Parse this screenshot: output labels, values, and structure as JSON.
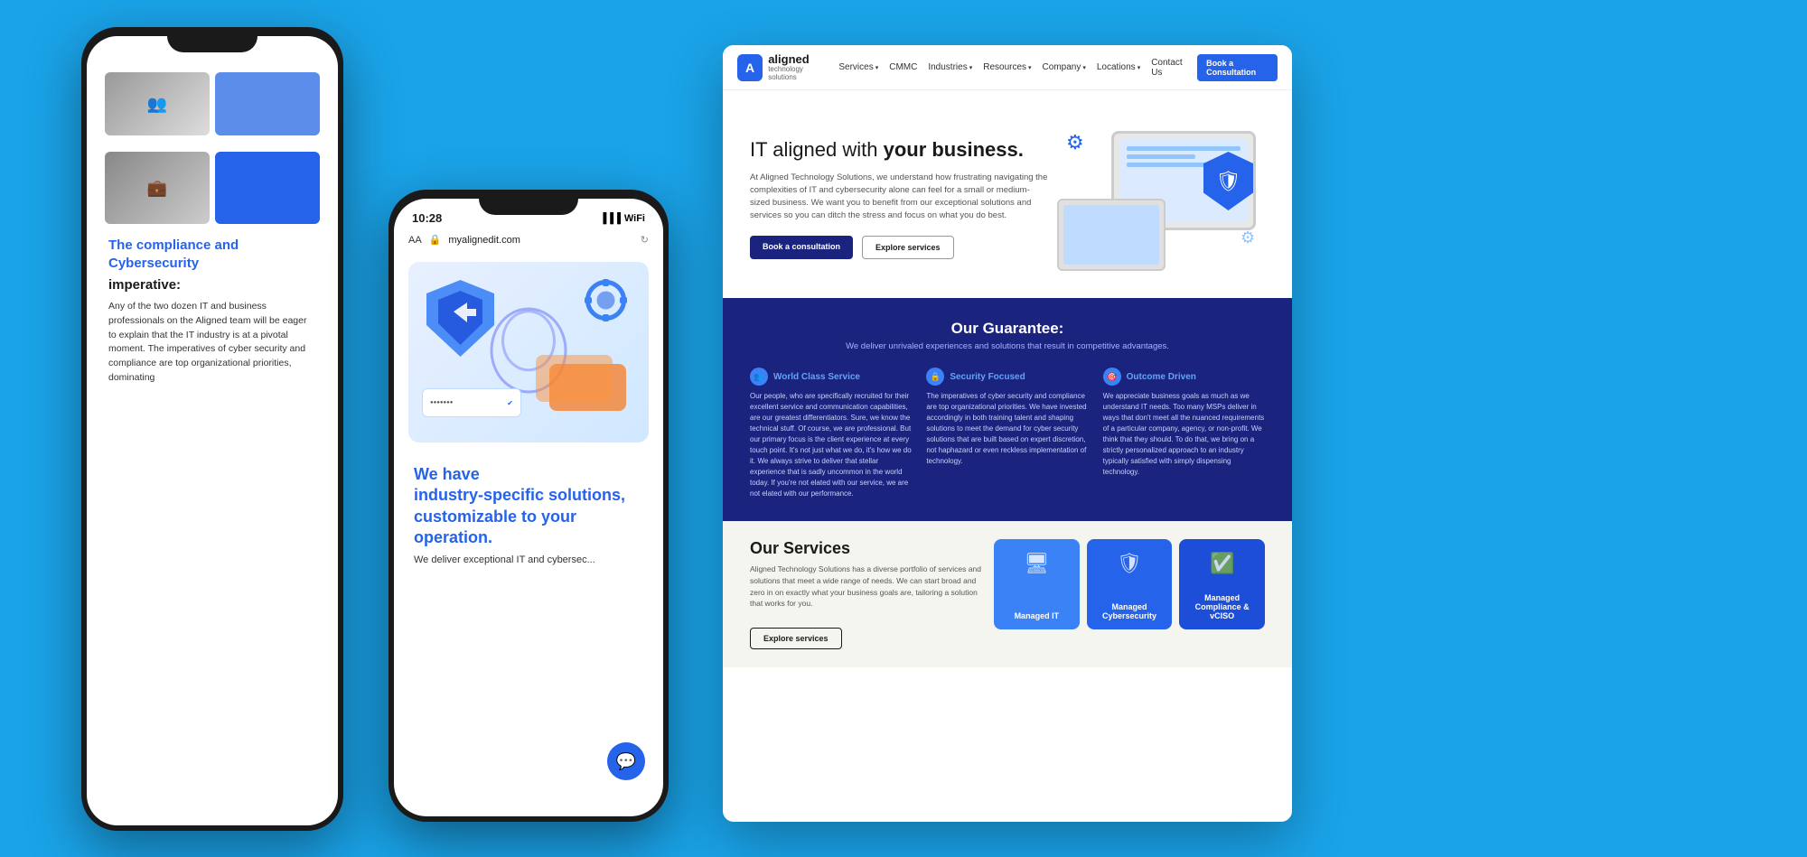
{
  "background_color": "#1aa3e8",
  "phone_left": {
    "heading_blue": "The compliance and Cybersecurity",
    "heading_bold": "imperative:",
    "body_text": "Any of the two dozen IT and business professionals on the Aligned team will be eager to explain that the IT industry is at a pivotal moment. The imperatives of cyber security and compliance are top organizational priorities, dominating"
  },
  "phone_mid": {
    "status_bar": {
      "time": "10:28",
      "url": "myalignedit.com",
      "aa_label": "AA"
    },
    "heading_line1": "We have",
    "heading_line2": "industry-specific solutions,",
    "heading_bold": "customizable to your operation.",
    "subtext": "We deliver exceptional IT and cybersec..."
  },
  "browser": {
    "nav": {
      "logo_text": "aligned",
      "logo_sub": "technology solutions",
      "links": [
        "Services",
        "CMMC",
        "Industries",
        "Resources",
        "Company",
        "Locations",
        "Contact Us"
      ],
      "cta_button": "Book a Consultation"
    },
    "hero": {
      "title_normal": "IT aligned with",
      "title_bold": "your business.",
      "body": "At Aligned Technology Solutions, we understand how frustrating navigating the complexities of IT and cybersecurity alone can feel for a small or medium-sized business. We want you to benefit from our exceptional solutions and services so you can ditch the stress and focus on what you do best.",
      "btn_consultation": "Book a consultation",
      "btn_services": "Explore services"
    },
    "guarantee": {
      "title": "Our Guarantee:",
      "subtitle": "We deliver unrivaled experiences and solutions that result in competitive advantages.",
      "cols": [
        {
          "title": "World Class Service",
          "body": "Our people, who are specifically recruited for their excellent service and communication capabilities, are our greatest differentiators. Sure, we know the technical stuff. Of course, we are professional. But our primary focus is the client experience at every touch point. It's not just what we do, it's how we do it. We always strive to deliver that stellar experience that is sadly uncommon in the world today. If you're not elated with our service, we are not elated with our performance."
        },
        {
          "title": "Security Focused",
          "body": "The imperatives of cyber security and compliance are top organizational priorities. We have invested accordingly in both training talent and shaping solutions to meet the demand for cyber security solutions that are built based on expert discretion, not haphazard or even reckless implementation of technology."
        },
        {
          "title": "Outcome Driven",
          "body": "We appreciate business goals as much as we understand IT needs. Too many MSPs deliver in ways that don't meet all the nuanced requirements of a particular company, agency, or non-profit. We think that they should. To do that, we bring on a strictly personalized approach to an industry typically satisfied with simply dispensing technology."
        }
      ]
    },
    "services": {
      "title": "Our Services",
      "body": "Aligned Technology Solutions has a diverse portfolio of services and solutions that meet a wide range of needs. We can start broad and zero in on exactly what your business goals are, tailoring a solution that works for you.",
      "btn": "Explore services",
      "cards": [
        {
          "label": "Managed IT",
          "color": "blue1"
        },
        {
          "label": "Managed Cybersecurity",
          "color": "blue2"
        },
        {
          "label": "Managed Compliance & vCISO",
          "color": "blue3"
        }
      ]
    }
  }
}
